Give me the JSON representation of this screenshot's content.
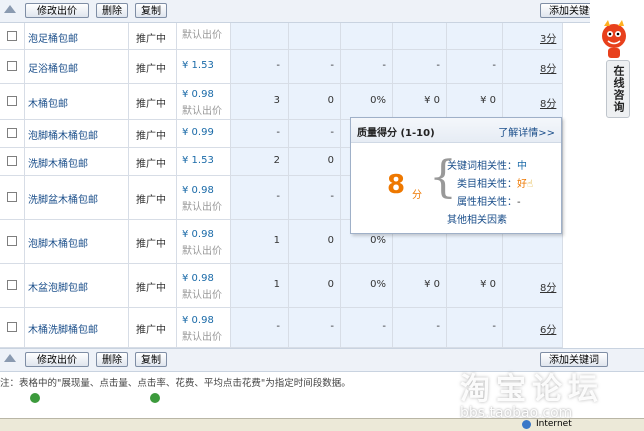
{
  "toolbar": {
    "modify_bid": "修改出价",
    "delete": "删除",
    "copy": "复制",
    "add_keyword": "添加关键词"
  },
  "rows": [
    {
      "keyword": "泡足桶包邮",
      "status": "推广中",
      "bid": "",
      "default": "默认出价",
      "impressions": "",
      "clicks": "",
      "ctr": "",
      "cost": "",
      "avg_cpc": "",
      "score": "3分"
    },
    {
      "keyword": "足浴桶包邮",
      "status": "推广中",
      "bid": "¥ 1.53",
      "default": "",
      "impressions": "-",
      "clicks": "-",
      "ctr": "-",
      "cost": "-",
      "avg_cpc": "-",
      "score": "8分"
    },
    {
      "keyword": "木桶包邮",
      "status": "推广中",
      "bid": "¥ 0.98",
      "default": "默认出价",
      "impressions": "3",
      "clicks": "0",
      "ctr": "0%",
      "cost": "¥ 0",
      "avg_cpc": "¥ 0",
      "score": "8分"
    },
    {
      "keyword": "泡脚桶木桶包邮",
      "status": "推广中",
      "bid": "¥ 0.99",
      "default": "",
      "impressions": "-",
      "clicks": "-",
      "ctr": "",
      "cost": "",
      "avg_cpc": "",
      "score": ""
    },
    {
      "keyword": "洗脚木桶包邮",
      "status": "推广中",
      "bid": "¥ 1.53",
      "default": "",
      "impressions": "2",
      "clicks": "0",
      "ctr": "",
      "cost": "",
      "avg_cpc": "",
      "score": ""
    },
    {
      "keyword": "洗脚盆木桶包邮",
      "status": "推广中",
      "bid": "¥ 0.98",
      "default": "默认出价",
      "impressions": "-",
      "clicks": "-",
      "ctr": "",
      "cost": "",
      "avg_cpc": "",
      "score": ""
    },
    {
      "keyword": "泡脚木桶包邮",
      "status": "推广中",
      "bid": "¥ 0.98",
      "default": "默认出价",
      "impressions": "1",
      "clicks": "0",
      "ctr": "0%",
      "cost": "",
      "avg_cpc": "",
      "score": ""
    },
    {
      "keyword": "木盆泡脚包邮",
      "status": "推广中",
      "bid": "¥ 0.98",
      "default": "默认出价",
      "impressions": "1",
      "clicks": "0",
      "ctr": "0%",
      "cost": "¥ 0",
      "avg_cpc": "¥ 0",
      "score": "8分"
    },
    {
      "keyword": "木桶洗脚桶包邮",
      "status": "推广中",
      "bid": "¥ 0.98",
      "default": "默认出价",
      "impressions": "-",
      "clicks": "-",
      "ctr": "-",
      "cost": "-",
      "avg_cpc": "-",
      "score": "6分"
    }
  ],
  "popup": {
    "title": "质量得分 (1-10)",
    "more": "了解详情>>",
    "score": "8",
    "unit": "分",
    "kw_rel_label": "关键词相关性：",
    "kw_rel_value": "中",
    "cat_rel_label": "类目相关性：",
    "cat_rel_value": "好",
    "attr_rel_label": "属性相关性：",
    "attr_rel_value": "-",
    "other_factors": "其他相关因素"
  },
  "side": {
    "consult": "在线咨询"
  },
  "footnote": "注：表格中的\"展现量、点击量、点击率、花费、平均点击花费\"为指定时间段数据。",
  "watermark": {
    "logo": "淘宝论坛",
    "url": "bbs.taobao.com"
  },
  "statusbar": {
    "zone": "Internet"
  },
  "colors": {
    "link": "#1a4e8a",
    "score_orange": "#ee7800",
    "column_blue": "#e8f1fb"
  }
}
